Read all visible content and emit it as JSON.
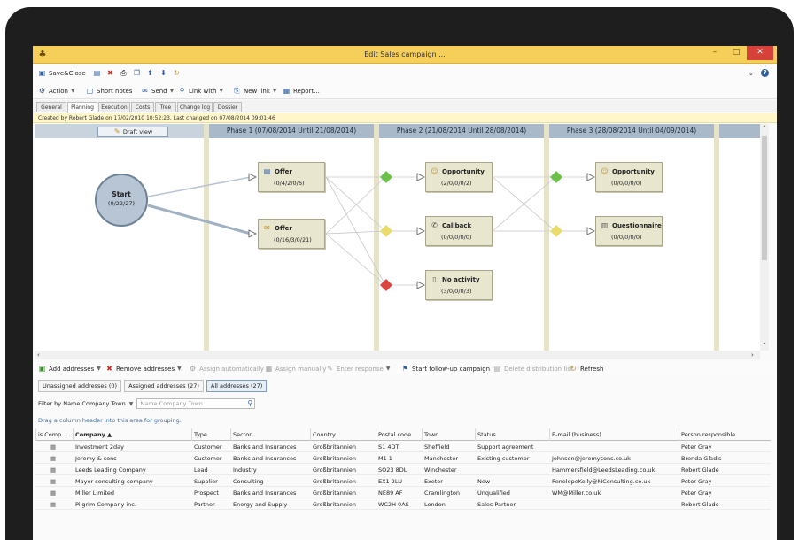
{
  "window": {
    "title": "Edit Sales campaign ...",
    "app_icon": "app-icon",
    "controls": {
      "minimize": "–",
      "maximize": "□",
      "close": "✕"
    }
  },
  "toolbar1": {
    "save_close": "Save&Close",
    "help": "?",
    "collapse": "⌄"
  },
  "toolbar2": {
    "action": "Action",
    "short_notes": "Short notes",
    "send": "Send",
    "link_with": "Link with",
    "new_link": "New link",
    "report": "Report..."
  },
  "tabs": [
    "General",
    "Planning",
    "Execution",
    "Costs",
    "Tree",
    "Change log",
    "Dossier"
  ],
  "active_tab": "Planning",
  "info": "Created by Robert Glade on 17/02/2010 10:52:23, Last changed on 07/08/2014 09:01:46",
  "planning": {
    "draft_view": "Draft view",
    "phases": [
      "Phase 1 (07/08/2014 Until 21/08/2014)",
      "Phase 2 (21/08/2014 Until 28/08/2014)",
      "Phase 3 (28/08/2014 Until 04/09/2014)"
    ],
    "start": {
      "label": "Start",
      "counts": "(0/22/27)"
    },
    "activities": [
      {
        "label": "Offer",
        "counts": "(0/4/2/0/6)",
        "icon": "offer-icon"
      },
      {
        "label": "Offer",
        "counts": "(0/16/3/0/21)",
        "icon": "mail-offer-icon"
      },
      {
        "label": "Opportunity",
        "counts": "(2/0/0/0/2)",
        "icon": "opportunity-icon"
      },
      {
        "label": "Callback",
        "counts": "(0/0/0/0/0)",
        "icon": "phone-icon"
      },
      {
        "label": "No activity",
        "counts": "(3/0/0/0/3)",
        "icon": "document-icon"
      },
      {
        "label": "Opportunity",
        "counts": "(0/0/0/0/0)",
        "icon": "opportunity-icon"
      },
      {
        "label": "Questionnaire",
        "counts": "(0/0/0/0/0)",
        "icon": "questionnaire-icon"
      }
    ],
    "colors": {
      "green": "#6cc24a",
      "yellow": "#e9dc6a",
      "red": "#d9453f"
    }
  },
  "addresses_toolbar": {
    "add": "Add addresses",
    "remove": "Remove addresses",
    "assign_auto": "Assign automatically",
    "assign_manual": "Assign manually",
    "enter_response": "Enter response",
    "follow_up": "Start follow-up campaign",
    "delete_list": "Delete distribution list",
    "refresh": "Refresh"
  },
  "address_tabs": [
    "Unassigned addresses (0)",
    "Assigned addresses (27)",
    "All addresses (27)"
  ],
  "filter": {
    "label": "Filter by Name Company Town",
    "placeholder": "Name Company Town"
  },
  "grouping_hint": "Drag a column header into this area for grouping.",
  "table": {
    "columns": [
      "is Comp...",
      "Company ▲",
      "Type",
      "Sector",
      "Country",
      "Postal code",
      "Town",
      "Status",
      "E-mail (business)",
      "Person responsible"
    ],
    "rows": [
      [
        "Investment 2day",
        "Customer",
        "Banks and Insurances",
        "Großbritannien",
        "S1 4DT",
        "Sheffield",
        "Support agreement",
        "",
        "Peter Gray"
      ],
      [
        "Jeremy & sons",
        "Customer",
        "Banks and Insurances",
        "Großbritannien",
        "M1 1",
        "Manchester",
        "Existing customer",
        "Johnson@jeremysons.co.uk",
        "Brenda Gladis"
      ],
      [
        "Leeds Leading Company",
        "Lead",
        "Industry",
        "Großbritannien",
        "SO23 8DL",
        "Winchester",
        "",
        "Hammersfield@LeedsLeading.co.uk",
        "Robert Glade"
      ],
      [
        "Mayer consulting company",
        "Supplier",
        "Consulting",
        "Großbritannien",
        "EX1 2LU",
        "Exeter",
        "New",
        "PenelopeKelly@MConsulting.co.uk",
        "Peter Gray"
      ],
      [
        "Miller Limited",
        "Prospect",
        "Banks and Insurances",
        "Großbritannien",
        "NE89 AF",
        "Cramlington",
        "Unqualified",
        "WM@Miller.co.uk",
        "Peter Gray"
      ],
      [
        "Pilgrim Company inc.",
        "Partner",
        "Energy and Supply",
        "Großbritannien",
        "WC2H 0AS",
        "London",
        "Sales Partner",
        "",
        "Robert Glade"
      ]
    ]
  }
}
